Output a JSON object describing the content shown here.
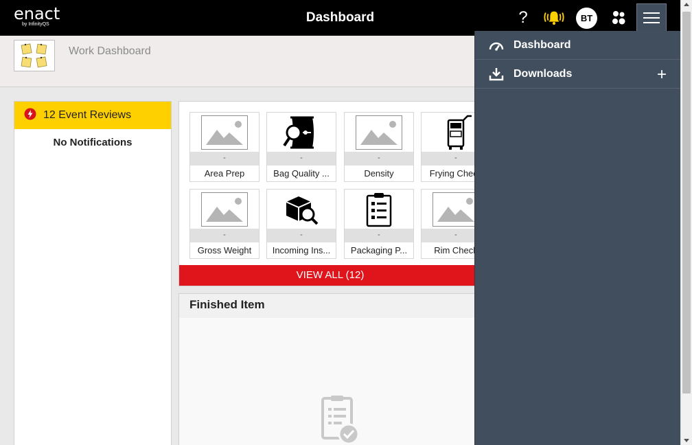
{
  "header": {
    "brand_name": "enact",
    "brand_sub": "by InfinityQS",
    "title": "Dashboard",
    "help_label": "?",
    "avatar_initials": "BT"
  },
  "subheader": {
    "title": "Work Dashboard"
  },
  "notifications": {
    "event_reviews": "12 Event Reviews",
    "empty_text": "No Notifications"
  },
  "tiles": [
    {
      "label": "Area Prep",
      "value": "-",
      "icon": "placeholder-image-icon"
    },
    {
      "label": "Bag Quality ...",
      "value": "-",
      "icon": "bag-inspect-icon"
    },
    {
      "label": "Density",
      "value": "-",
      "icon": "placeholder-image-icon"
    },
    {
      "label": "Frying Check",
      "value": "-",
      "icon": "fryer-icon"
    },
    {
      "label": "Gross Weight",
      "value": "-",
      "icon": "placeholder-image-icon"
    },
    {
      "label": "Incoming Ins...",
      "value": "-",
      "icon": "box-inspect-icon"
    },
    {
      "label": "Packaging P...",
      "value": "-",
      "icon": "clipboard-checklist-icon"
    },
    {
      "label": "Rim Check",
      "value": "-",
      "icon": "placeholder-image-icon"
    }
  ],
  "view_all_label": "VIEW ALL (12)",
  "finished_item": {
    "title": "Finished Item"
  },
  "drawer": {
    "items": [
      {
        "label": "Dashboard",
        "icon": "gauge-icon"
      },
      {
        "label": "Downloads",
        "icon": "download-icon",
        "action": "+"
      }
    ]
  },
  "colors": {
    "topbar": "#000000",
    "event_bar": "#ffd000",
    "view_all": "#e0141b",
    "drawer": "#404e5d",
    "bell": "#ffd000"
  }
}
